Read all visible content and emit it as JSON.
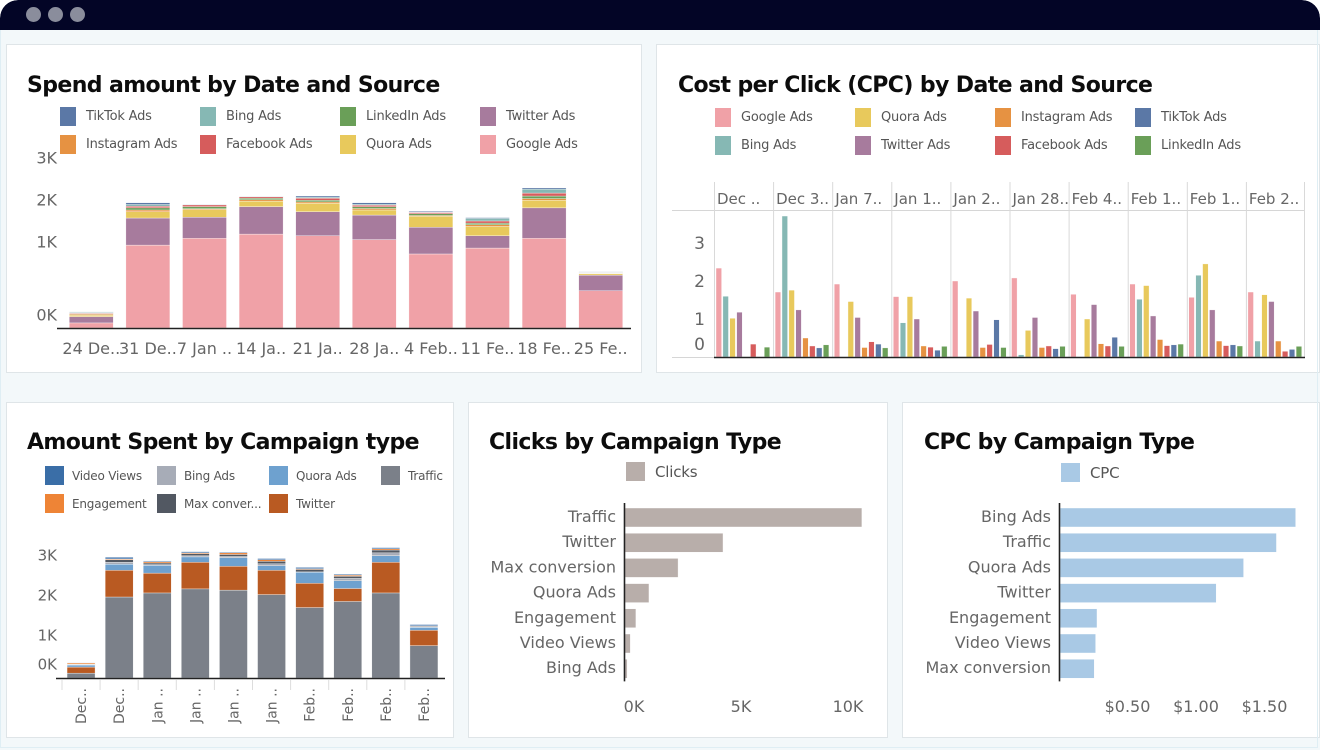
{
  "window": {
    "controls": [
      "close",
      "minimize",
      "maximize"
    ]
  },
  "colors": {
    "source": {
      "TikTok Ads": "#5b78a6",
      "Bing Ads": "#86b8b4",
      "LinkedIn Ads": "#6a9f58",
      "Twitter Ads": "#a77b9d",
      "Instagram Ads": "#e69242",
      "Facebook Ads": "#d65c5c",
      "Quora Ads": "#e8c95c",
      "Google Ads": "#f0a1a7"
    },
    "campaign": {
      "Video Views": "#3a6ea7",
      "Bing Ads": "#a7acb7",
      "Quora Ads": "#6ea1cf",
      "Traffic": "#7b8089",
      "Engagement": "#ee8436",
      "Max conversion": "#525862",
      "Twitter": "#b95a22"
    },
    "clicks_bar": "#b8aeaa",
    "cpc_bar": "#a9c9e5",
    "axis_text": "#666666"
  },
  "panels": {
    "spend_by_date": {
      "title": "Spend amount by Date and Source",
      "legend": [
        {
          "label": "TikTok Ads",
          "key": "TikTok Ads"
        },
        {
          "label": "Bing Ads",
          "key": "Bing Ads"
        },
        {
          "label": "LinkedIn Ads",
          "key": "LinkedIn Ads"
        },
        {
          "label": "Twitter Ads",
          "key": "Twitter Ads"
        },
        {
          "label": "Instagram Ads",
          "key": "Instagram Ads"
        },
        {
          "label": "Facebook Ads",
          "key": "Facebook Ads"
        },
        {
          "label": "Quora Ads",
          "key": "Quora Ads"
        },
        {
          "label": "Google Ads",
          "key": "Google Ads"
        }
      ]
    },
    "cpc_by_date": {
      "title": "Cost per Click (CPC) by Date and Source",
      "legend": [
        {
          "label": "Google Ads",
          "key": "Google Ads"
        },
        {
          "label": "Quora Ads",
          "key": "Quora Ads"
        },
        {
          "label": "Instagram Ads",
          "key": "Instagram Ads"
        },
        {
          "label": "TikTok Ads",
          "key": "TikTok Ads"
        },
        {
          "label": "Bing Ads",
          "key": "Bing Ads"
        },
        {
          "label": "Twitter Ads",
          "key": "Twitter Ads"
        },
        {
          "label": "Facebook Ads",
          "key": "Facebook Ads"
        },
        {
          "label": "LinkedIn Ads",
          "key": "LinkedIn Ads"
        }
      ]
    },
    "spend_by_campaign": {
      "title": "Amount Spent by Campaign type",
      "legend": [
        {
          "label": "Video Views",
          "key": "Video Views"
        },
        {
          "label": "Bing Ads",
          "key": "Bing Ads"
        },
        {
          "label": "Quora Ads",
          "key": "Quora Ads"
        },
        {
          "label": "Traffic",
          "key": "Traffic"
        },
        {
          "label": "Engagement",
          "key": "Engagement"
        },
        {
          "label": "Max conver...",
          "key": "Max conversion"
        },
        {
          "label": "Twitter",
          "key": "Twitter"
        }
      ]
    },
    "clicks_by_campaign": {
      "title": "Clicks by Campaign Type",
      "legend": [
        {
          "label": "Clicks"
        }
      ]
    },
    "cpc_by_campaign": {
      "title": "CPC by Campaign Type",
      "legend": [
        {
          "label": "CPC"
        }
      ]
    }
  },
  "chart_data": [
    {
      "id": "spend_by_date",
      "type": "bar",
      "stacked": true,
      "title": "Spend amount by Date and Source",
      "xlabel": "",
      "ylabel": "",
      "categories": [
        "24 De..",
        "31 De..",
        "7 Jan ..",
        "14 Ja..",
        "21 Ja..",
        "28 Ja..",
        "4 Feb..",
        "11 Fe..",
        "18 Fe..",
        "25 Fe.."
      ],
      "y_ticks": [
        "0K",
        "1K",
        "2K",
        "3K"
      ],
      "ylim": [
        0,
        3300
      ],
      "legend_position": "top",
      "stack_order": [
        "Google Ads",
        "Twitter Ads",
        "Quora Ads",
        "Instagram Ads",
        "LinkedIn Ads",
        "Facebook Ads",
        "Bing Ads",
        "TikTok Ads"
      ],
      "series": [
        {
          "name": "Google Ads",
          "values": [
            120,
            1960,
            2120,
            2220,
            2180,
            2090,
            1750,
            1890,
            2120,
            880
          ]
        },
        {
          "name": "Twitter Ads",
          "values": [
            150,
            640,
            500,
            650,
            570,
            580,
            630,
            290,
            720,
            370
          ]
        },
        {
          "name": "Quora Ads",
          "values": [
            30,
            150,
            180,
            130,
            200,
            120,
            260,
            220,
            180,
            30
          ]
        },
        {
          "name": "Instagram Ads",
          "values": [
            25,
            40,
            20,
            30,
            30,
            35,
            20,
            40,
            40,
            10
          ]
        },
        {
          "name": "LinkedIn Ads",
          "values": [
            15,
            50,
            50,
            40,
            40,
            40,
            40,
            40,
            60,
            10
          ]
        },
        {
          "name": "Facebook Ads",
          "values": [
            15,
            40,
            40,
            30,
            50,
            40,
            30,
            50,
            70,
            10
          ]
        },
        {
          "name": "Bing Ads",
          "values": [
            15,
            40,
            10,
            10,
            20,
            20,
            10,
            60,
            90,
            10
          ]
        },
        {
          "name": "TikTok Ads",
          "values": [
            10,
            40,
            10,
            10,
            30,
            35,
            20,
            20,
            30,
            10
          ]
        }
      ]
    },
    {
      "id": "cpc_by_date",
      "type": "bar",
      "grouped": true,
      "title": "Cost per Click (CPC) by Date and Source",
      "xlabel": "",
      "ylabel": "",
      "categories": [
        "Dec ..",
        "Dec 3..",
        "Jan 7..",
        "Jan 1..",
        "Jan 2..",
        "Jan 28..",
        "Feb 4..",
        "Feb 1..",
        "Feb 1..",
        "Feb 2.."
      ],
      "y_ticks": [
        "0",
        "1",
        "2",
        "3"
      ],
      "ylim": [
        0,
        4
      ],
      "legend_position": "top",
      "group_order": [
        "Google Ads",
        "Bing Ads",
        "Quora Ads",
        "Twitter Ads",
        "Instagram Ads",
        "Facebook Ads",
        "TikTok Ads",
        "LinkedIn Ads"
      ],
      "series": [
        {
          "name": "Google Ads",
          "values": [
            2.34,
            1.71,
            1.92,
            1.59,
            2.0,
            2.08,
            1.65,
            1.92,
            1.57,
            1.71
          ]
        },
        {
          "name": "Bing Ads",
          "values": [
            1.6,
            3.71,
            null,
            0.9,
            null,
            0.06,
            null,
            1.52,
            2.15,
            0.42
          ]
        },
        {
          "name": "Quora Ads",
          "values": [
            1.02,
            1.76,
            1.46,
            1.59,
            1.55,
            0.7,
            1.0,
            1.88,
            2.45,
            1.64
          ]
        },
        {
          "name": "Twitter Ads",
          "values": [
            1.18,
            1.24,
            1.04,
            1.0,
            1.21,
            1.04,
            1.38,
            1.08,
            1.24,
            1.46
          ]
        },
        {
          "name": "Instagram Ads",
          "values": [
            null,
            0.5,
            0.25,
            0.29,
            0.25,
            0.25,
            0.35,
            0.46,
            0.42,
            0.42
          ]
        },
        {
          "name": "Facebook Ads",
          "values": [
            0.34,
            0.29,
            0.4,
            0.26,
            0.33,
            0.29,
            0.29,
            0.3,
            0.3,
            0.15
          ]
        },
        {
          "name": "TikTok Ads",
          "values": [
            null,
            0.24,
            0.34,
            0.18,
            0.98,
            0.22,
            0.52,
            0.32,
            0.32,
            0.2
          ]
        },
        {
          "name": "LinkedIn Ads",
          "values": [
            0.26,
            0.32,
            0.24,
            0.28,
            0.25,
            0.28,
            0.28,
            0.34,
            0.29,
            0.28
          ]
        }
      ]
    },
    {
      "id": "spend_by_campaign",
      "type": "bar",
      "stacked": true,
      "title": "Amount Spent by Campaign type",
      "xlabel": "",
      "ylabel": "",
      "categories": [
        "Dec..",
        "Dec..",
        "Jan ..",
        "Jan ..",
        "Jan ..",
        "Jan ..",
        "Feb..",
        "Feb..",
        "Feb..",
        "Feb.."
      ],
      "y_ticks": [
        "0K",
        "1K",
        "2K",
        "3K"
      ],
      "ylim": [
        0,
        3300
      ],
      "legend_position": "top",
      "stack_order": [
        "Traffic",
        "Twitter",
        "Quora Ads",
        "Bing Ads",
        "Max conversion",
        "Engagement",
        "Video Views"
      ],
      "series": [
        {
          "name": "Traffic",
          "values": [
            120,
            2000,
            2100,
            2200,
            2170,
            2060,
            1740,
            1890,
            2100,
            800
          ]
        },
        {
          "name": "Twitter",
          "values": [
            150,
            660,
            490,
            660,
            590,
            600,
            600,
            320,
            760,
            380
          ]
        },
        {
          "name": "Quora Ads",
          "values": [
            50,
            150,
            190,
            130,
            210,
            110,
            270,
            190,
            160,
            70
          ]
        },
        {
          "name": "Bing Ads",
          "values": [
            10,
            50,
            20,
            30,
            30,
            50,
            10,
            60,
            70,
            10
          ]
        },
        {
          "name": "Max conversion",
          "values": [
            10,
            60,
            40,
            50,
            50,
            60,
            60,
            50,
            70,
            20
          ]
        },
        {
          "name": "Engagement",
          "values": [
            30,
            20,
            30,
            20,
            40,
            40,
            20,
            30,
            30,
            10
          ]
        },
        {
          "name": "Video Views",
          "values": [
            10,
            40,
            20,
            30,
            20,
            30,
            30,
            20,
            30,
            30
          ]
        }
      ]
    },
    {
      "id": "clicks_by_campaign",
      "type": "bar",
      "orientation": "horizontal",
      "title": "Clicks by Campaign Type",
      "xlabel": "",
      "ylabel": "",
      "categories": [
        "Traffic",
        "Twitter",
        "Max conversion",
        "Quora Ads",
        "Engagement",
        "Video Views",
        "Bing Ads"
      ],
      "values": [
        11070,
        4580,
        2480,
        1120,
        510,
        250,
        100
      ],
      "x_ticks": [
        {
          "value": 0,
          "label": "0K"
        },
        {
          "value": 5000,
          "label": "5K"
        },
        {
          "value": 10000,
          "label": "10K"
        }
      ],
      "xlim": [
        0,
        11500
      ],
      "legend": [
        "Clicks"
      ],
      "legend_position": "top"
    },
    {
      "id": "cpc_by_campaign",
      "type": "bar",
      "orientation": "horizontal",
      "title": "CPC by Campaign Type",
      "xlabel": "",
      "ylabel": "",
      "categories": [
        "Bing Ads",
        "Traffic",
        "Quora Ads",
        "Twitter",
        "Engagement",
        "Video Views",
        "Max conversion"
      ],
      "values": [
        1.72,
        1.58,
        1.34,
        1.14,
        0.27,
        0.26,
        0.25
      ],
      "x_ticks": [
        {
          "value": 0.5,
          "label": "$0.50"
        },
        {
          "value": 1.0,
          "label": "$1.00"
        },
        {
          "value": 1.5,
          "label": "$1.50"
        }
      ],
      "xlim": [
        0,
        1.8
      ],
      "legend": [
        "CPC"
      ],
      "legend_position": "top"
    }
  ]
}
